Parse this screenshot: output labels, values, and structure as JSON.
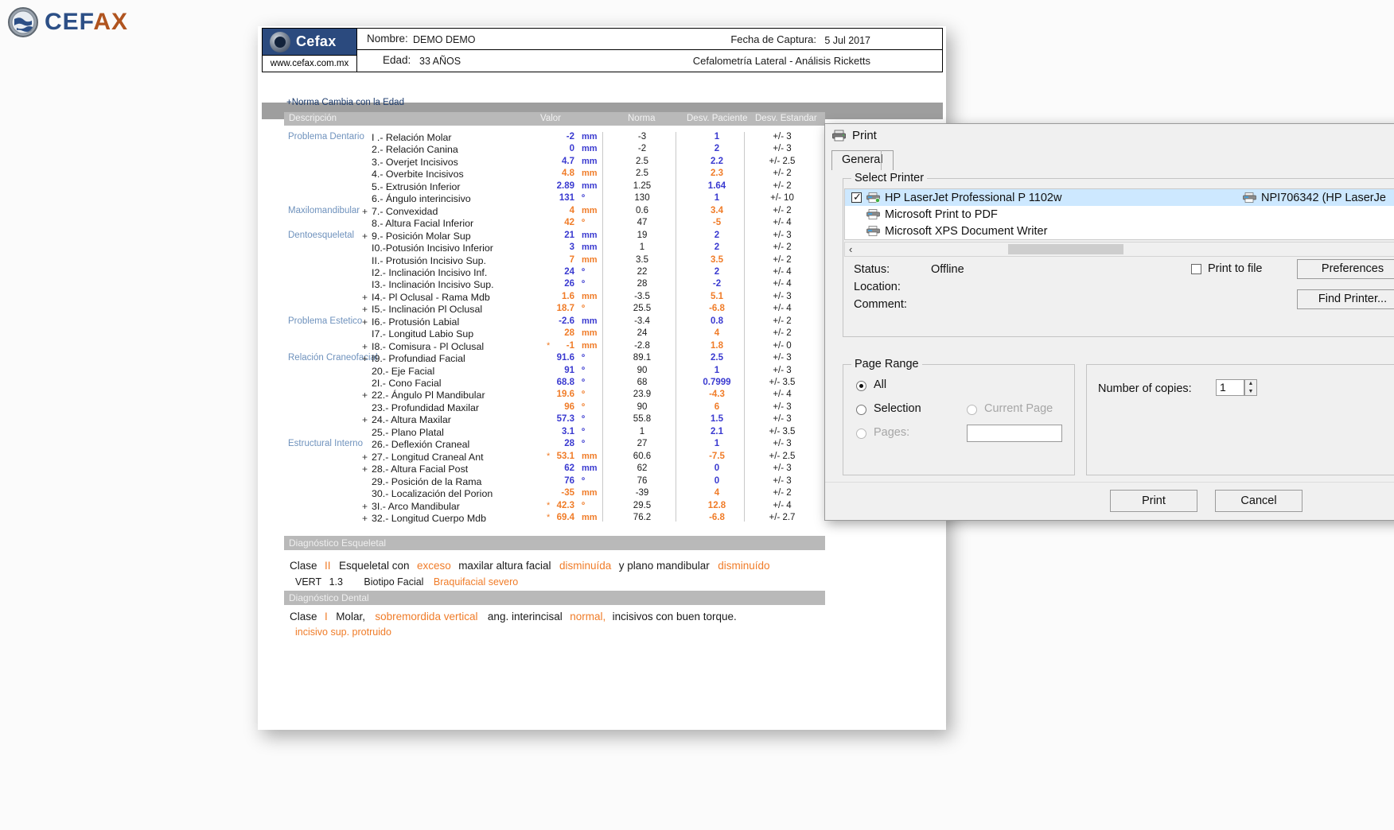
{
  "brand": {
    "name_part1": "CEF",
    "name_part2": "AX",
    "logo_icon": "globe-icon"
  },
  "report": {
    "logo_word": "Cefax",
    "url": "www.cefax.com.mx",
    "name_label": "Nombre:",
    "name_value": "DEMO DEMO",
    "age_label": "Edad:",
    "age_value": "33 AÑOS",
    "capture_label": "Fecha de Captura:",
    "capture_value": "5 Jul 2017",
    "analysis_title": "Cefalometría Lateral - Análisis Ricketts",
    "norma_note": "+Norma Cambia con la Edad",
    "columns": [
      "Descripción",
      "Valor",
      "Norma",
      "Desv. Paciente",
      "Desv. Estandar"
    ],
    "rows": [
      {
        "group": "Problema Dentario",
        "plus": "",
        "star": "",
        "desc": "I .- Relación Molar",
        "value": "-2",
        "unit": "mm",
        "value_color": "blue",
        "norma": "-3",
        "desv_p": "1",
        "desv_p_color": "blue",
        "desv_e": "+/- 3"
      },
      {
        "group": "",
        "plus": "",
        "star": "",
        "desc": "2.- Relación Canina",
        "value": "0",
        "unit": "mm",
        "value_color": "blue",
        "norma": "-2",
        "desv_p": "2",
        "desv_p_color": "blue",
        "desv_e": "+/- 3"
      },
      {
        "group": "",
        "plus": "",
        "star": "",
        "desc": "3.- Overjet Incisivos",
        "value": "4.7",
        "unit": "mm",
        "value_color": "blue",
        "norma": "2.5",
        "desv_p": "2.2",
        "desv_p_color": "blue",
        "desv_e": "+/- 2.5"
      },
      {
        "group": "",
        "plus": "",
        "star": "",
        "desc": "4.- Overbite Incisivos",
        "value": "4.8",
        "unit": "mm",
        "value_color": "orange",
        "norma": "2.5",
        "desv_p": "2.3",
        "desv_p_color": "orange",
        "desv_e": "+/- 2"
      },
      {
        "group": "",
        "plus": "",
        "star": "",
        "desc": "5.- Extrusión  Inferior",
        "value": "2.89",
        "unit": "mm",
        "value_color": "blue",
        "norma": "1.25",
        "desv_p": "1.64",
        "desv_p_color": "blue",
        "desv_e": "+/- 2"
      },
      {
        "group": "",
        "plus": "",
        "star": "",
        "desc": "6.- Ángulo interincisivo",
        "value": "131",
        "unit": "º",
        "value_color": "blue",
        "norma": "130",
        "desv_p": "1",
        "desv_p_color": "blue",
        "desv_e": "+/- 10"
      },
      {
        "group": "Maxilomandibular",
        "plus": "+",
        "star": "",
        "desc": "7.- Convexidad",
        "value": "4",
        "unit": "mm",
        "value_color": "orange",
        "norma": "0.6",
        "desv_p": "3.4",
        "desv_p_color": "orange",
        "desv_e": "+/- 2"
      },
      {
        "group": "",
        "plus": "",
        "star": "",
        "desc": "8.- Altura Facial Inferior",
        "value": "42",
        "unit": "º",
        "value_color": "orange",
        "norma": "47",
        "desv_p": "-5",
        "desv_p_color": "orange",
        "desv_e": "+/- 4"
      },
      {
        "group": "Dentoesqueletal",
        "plus": "+",
        "star": "",
        "desc": "9.- Posición Molar Sup",
        "value": "21",
        "unit": "mm",
        "value_color": "blue",
        "norma": "19",
        "desv_p": "2",
        "desv_p_color": "blue",
        "desv_e": "+/- 3"
      },
      {
        "group": "",
        "plus": "",
        "star": "",
        "desc": "I0.-Potusión Incisivo Inferior",
        "value": "3",
        "unit": "mm",
        "value_color": "blue",
        "norma": "1",
        "desv_p": "2",
        "desv_p_color": "blue",
        "desv_e": "+/- 2"
      },
      {
        "group": "",
        "plus": "",
        "star": "",
        "desc": "II.- Protusión Incisivo Sup.",
        "value": "7",
        "unit": "mm",
        "value_color": "orange",
        "norma": "3.5",
        "desv_p": "3.5",
        "desv_p_color": "orange",
        "desv_e": "+/- 2"
      },
      {
        "group": "",
        "plus": "",
        "star": "",
        "desc": "I2.- Inclinación Incisivo Inf.",
        "value": "24",
        "unit": "º",
        "value_color": "blue",
        "norma": "22",
        "desv_p": "2",
        "desv_p_color": "blue",
        "desv_e": "+/- 4"
      },
      {
        "group": "",
        "plus": "",
        "star": "",
        "desc": "I3.- Inclinación Incisivo Sup.",
        "value": "26",
        "unit": "º",
        "value_color": "blue",
        "norma": "28",
        "desv_p": "-2",
        "desv_p_color": "blue",
        "desv_e": "+/- 4"
      },
      {
        "group": "",
        "plus": "+",
        "star": "",
        "desc": "I4.- Pl Oclusal - Rama Mdb",
        "value": "1.6",
        "unit": "mm",
        "value_color": "orange",
        "norma": "-3.5",
        "desv_p": "5.1",
        "desv_p_color": "orange",
        "desv_e": "+/- 3"
      },
      {
        "group": "",
        "plus": "+",
        "star": "",
        "desc": "I5.- Inclinación Pl Oclusal",
        "value": "18.7",
        "unit": "º",
        "value_color": "orange",
        "norma": "25.5",
        "desv_p": "-6.8",
        "desv_p_color": "orange",
        "desv_e": "+/- 4"
      },
      {
        "group": "Problema Estetico",
        "plus": "+",
        "star": "",
        "desc": "I6.- Protusión Labial",
        "value": "-2.6",
        "unit": "mm",
        "value_color": "blue",
        "norma": "-3.4",
        "desv_p": "0.8",
        "desv_p_color": "blue",
        "desv_e": "+/- 2"
      },
      {
        "group": "",
        "plus": "",
        "star": "",
        "desc": "I7.- Longitud Labio Sup",
        "value": "28",
        "unit": "mm",
        "value_color": "orange",
        "norma": "24",
        "desv_p": "4",
        "desv_p_color": "orange",
        "desv_e": "+/- 2"
      },
      {
        "group": "",
        "plus": "+",
        "star": "*",
        "desc": "I8.- Comisura - Pl Oclusal",
        "value": "-1",
        "unit": "mm",
        "value_color": "orange",
        "norma": "-2.8",
        "desv_p": "1.8",
        "desv_p_color": "orange",
        "desv_e": "+/- 0"
      },
      {
        "group": "Relación Craneofacial",
        "plus": "+",
        "star": "",
        "desc": "I9.- Profundiad Facial",
        "value": "91.6",
        "unit": "º",
        "value_color": "blue",
        "norma": "89.1",
        "desv_p": "2.5",
        "desv_p_color": "blue",
        "desv_e": "+/- 3"
      },
      {
        "group": "",
        "plus": "",
        "star": "",
        "desc": "20.- Eje Facial",
        "value": "91",
        "unit": "º",
        "value_color": "blue",
        "norma": "90",
        "desv_p": "1",
        "desv_p_color": "blue",
        "desv_e": "+/- 3"
      },
      {
        "group": "",
        "plus": "",
        "star": "",
        "desc": "2I.- Cono Facial",
        "value": "68.8",
        "unit": "º",
        "value_color": "blue",
        "norma": "68",
        "desv_p": "0.7999",
        "desv_p_color": "blue",
        "desv_e": "+/- 3.5"
      },
      {
        "group": "",
        "plus": "+",
        "star": "",
        "desc": "22.- Ángulo Pl Mandibular",
        "value": "19.6",
        "unit": "º",
        "value_color": "orange",
        "norma": "23.9",
        "desv_p": "-4.3",
        "desv_p_color": "orange",
        "desv_e": "+/- 4"
      },
      {
        "group": "",
        "plus": "",
        "star": "",
        "desc": "23.- Profundidad Maxilar",
        "value": "96",
        "unit": "º",
        "value_color": "orange",
        "norma": "90",
        "desv_p": "6",
        "desv_p_color": "orange",
        "desv_e": "+/- 3"
      },
      {
        "group": "",
        "plus": "+",
        "star": "",
        "desc": "24.- Altura Maxilar",
        "value": "57.3",
        "unit": "º",
        "value_color": "blue",
        "norma": "55.8",
        "desv_p": "1.5",
        "desv_p_color": "blue",
        "desv_e": "+/- 3"
      },
      {
        "group": "",
        "plus": "",
        "star": "",
        "desc": "25.- Plano Platal",
        "value": "3.1",
        "unit": "º",
        "value_color": "blue",
        "norma": "1",
        "desv_p": "2.1",
        "desv_p_color": "blue",
        "desv_e": "+/- 3.5"
      },
      {
        "group": "Estructural Interno",
        "plus": "",
        "star": "",
        "desc": "26.- Deflexión Craneal",
        "value": "28",
        "unit": "º",
        "value_color": "blue",
        "norma": "27",
        "desv_p": "1",
        "desv_p_color": "blue",
        "desv_e": "+/- 3"
      },
      {
        "group": "",
        "plus": "+",
        "star": "*",
        "desc": "27.- Longitud Craneal Ant",
        "value": "53.1",
        "unit": "mm",
        "value_color": "orange",
        "norma": "60.6",
        "desv_p": "-7.5",
        "desv_p_color": "orange",
        "desv_e": "+/- 2.5"
      },
      {
        "group": "",
        "plus": "+",
        "star": "",
        "desc": "28.- Altura Facial Post",
        "value": "62",
        "unit": "mm",
        "value_color": "blue",
        "norma": "62",
        "desv_p": "0",
        "desv_p_color": "blue",
        "desv_e": "+/- 3"
      },
      {
        "group": "",
        "plus": "",
        "star": "",
        "desc": "29.- Posición de la Rama",
        "value": "76",
        "unit": "º",
        "value_color": "blue",
        "norma": "76",
        "desv_p": "0",
        "desv_p_color": "blue",
        "desv_e": "+/- 3"
      },
      {
        "group": "",
        "plus": "",
        "star": "",
        "desc": "30.- Localización del Porion",
        "value": "-35",
        "unit": "mm",
        "value_color": "orange",
        "norma": "-39",
        "desv_p": "4",
        "desv_p_color": "orange",
        "desv_e": "+/- 2"
      },
      {
        "group": "",
        "plus": "+",
        "star": "*",
        "desc": "3I.- Arco Mandibular",
        "value": "42.3",
        "unit": "º",
        "value_color": "orange",
        "norma": "29.5",
        "desv_p": "12.8",
        "desv_p_color": "orange",
        "desv_e": "+/- 4"
      },
      {
        "group": "",
        "plus": "+",
        "star": "*",
        "desc": "32.- Longitud Cuerpo Mdb",
        "value": "69.4",
        "unit": "mm",
        "value_color": "orange",
        "norma": "76.2",
        "desv_p": "-6.8",
        "desv_p_color": "orange",
        "desv_e": "+/- 2.7"
      }
    ],
    "diag_skeletal": {
      "band": "Diagnóstico Esqueletal",
      "line1_a": "Clase",
      "line1_class": "II",
      "line1_b": "Esqueletal con",
      "line1_hl1": "exceso",
      "line1_c": "maxilar   altura facial",
      "line1_hl2": "disminuída",
      "line1_d": "y plano mandibular",
      "line1_hl3": "disminuído",
      "line2_a": "VERT",
      "line2_val": "1.3",
      "line2_b": "Biotipo Facial",
      "line2_hl": "Braquifacial severo"
    },
    "diag_dental": {
      "band": "Diagnóstico Dental",
      "line1_a": "Clase",
      "line1_class": "I",
      "line1_b": "Molar,",
      "line1_hl1": "sobremordida vertical",
      "line1_c": "ang. interincisal",
      "line1_hl2": "normal,",
      "line1_d": "incisivos con buen torque.",
      "line2_hl": "incisivo sup. protruido"
    }
  },
  "print_dialog": {
    "title": "Print",
    "title_icon": "printer-icon",
    "close_label": "✕",
    "tab_general": "General",
    "select_printer_group": "Select Printer",
    "printers": [
      {
        "name": "HP LaserJet Professional P 1102w",
        "selected": true,
        "checked": true
      },
      {
        "name": "Microsoft Print to PDF",
        "selected": false,
        "checked": false
      },
      {
        "name": "Microsoft XPS Document Writer",
        "selected": false,
        "checked": false
      }
    ],
    "printer_right_label": "NPI706342 (HP LaserJe",
    "scroll_left_icon": "chevron-left-icon",
    "scroll_right_icon": "chevron-right-icon",
    "status_label": "Status:",
    "status_value": "Offline",
    "location_label": "Location:",
    "location_value": "",
    "comment_label": "Comment:",
    "comment_value": "",
    "print_to_file_label": "Print to file",
    "print_to_file_checked": false,
    "preferences_button": "Preferences",
    "find_printer_button": "Find Printer...",
    "page_range_group": "Page Range",
    "radio_all": "All",
    "radio_selection": "Selection",
    "radio_current_page": "Current Page",
    "radio_pages": "Pages:",
    "pages_value": "",
    "copies_label": "Number of copies:",
    "copies_value": "1",
    "print_button": "Print",
    "cancel_button": "Cancel"
  }
}
